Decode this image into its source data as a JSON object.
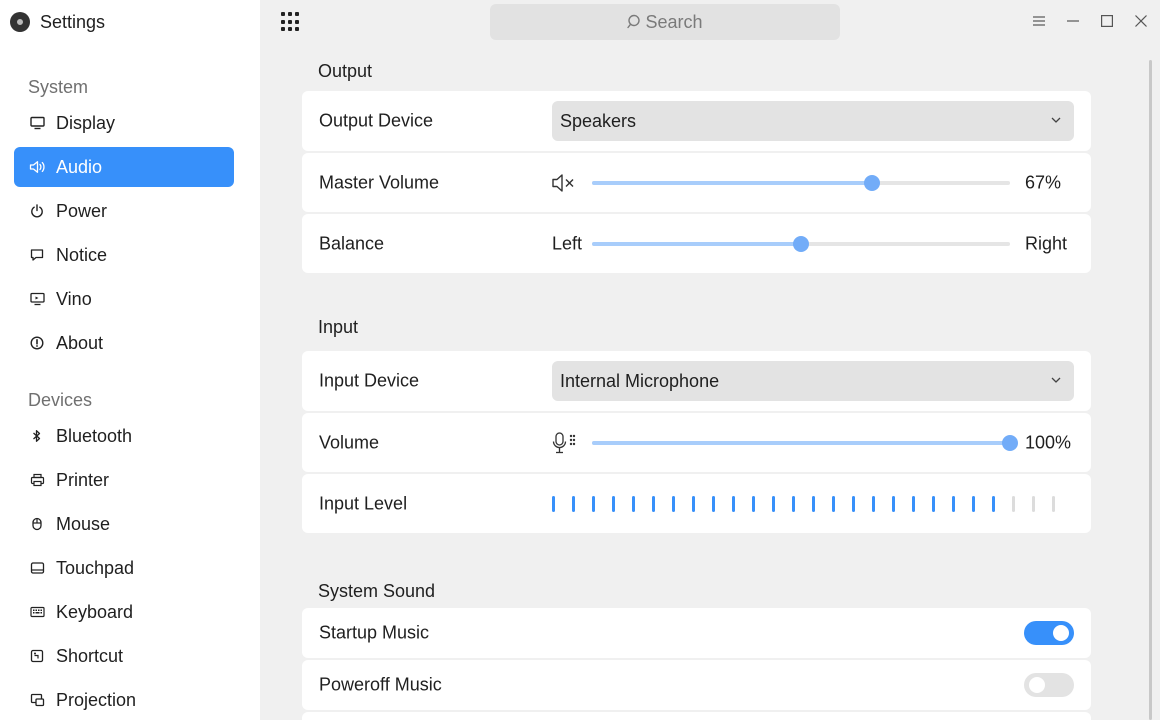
{
  "app": {
    "title": "Settings"
  },
  "sidebar": {
    "system_label": "System",
    "system_items": [
      {
        "label": "Display",
        "icon": "monitor-icon"
      },
      {
        "label": "Audio",
        "icon": "speaker-icon",
        "active": true
      },
      {
        "label": "Power",
        "icon": "power-icon"
      },
      {
        "label": "Notice",
        "icon": "notice-icon"
      },
      {
        "label": "Vino",
        "icon": "remote-desktop-icon"
      },
      {
        "label": "About",
        "icon": "info-icon"
      }
    ],
    "devices_label": "Devices",
    "devices_items": [
      {
        "label": "Bluetooth",
        "icon": "bluetooth-icon"
      },
      {
        "label": "Printer",
        "icon": "printer-icon"
      },
      {
        "label": "Mouse",
        "icon": "mouse-icon"
      },
      {
        "label": "Touchpad",
        "icon": "touchpad-icon"
      },
      {
        "label": "Keyboard",
        "icon": "keyboard-icon"
      },
      {
        "label": "Shortcut",
        "icon": "shortcut-icon"
      },
      {
        "label": "Projection",
        "icon": "projection-icon"
      }
    ]
  },
  "search": {
    "placeholder": "Search"
  },
  "output": {
    "title": "Output",
    "device_label": "Output Device",
    "device_value": "Speakers",
    "volume_label": "Master Volume",
    "volume_value": 67,
    "volume_text": "67%",
    "balance_label": "Balance",
    "balance_value": 50,
    "balance_left": "Left",
    "balance_right": "Right"
  },
  "input": {
    "title": "Input",
    "device_label": "Input Device",
    "device_value": "Internal Microphone",
    "volume_label": "Volume",
    "volume_value": 100,
    "volume_text": "100%",
    "level_label": "Input Level",
    "level_active_bars": 23,
    "level_total_bars": 26
  },
  "system_sound": {
    "title": "System Sound",
    "startup_label": "Startup Music",
    "startup_on": true,
    "poweroff_label": "Poweroff Music",
    "poweroff_on": false
  },
  "colors": {
    "accent": "#3790fa",
    "slider_fill": "#a8cdfb",
    "knob": "#72acf8"
  }
}
